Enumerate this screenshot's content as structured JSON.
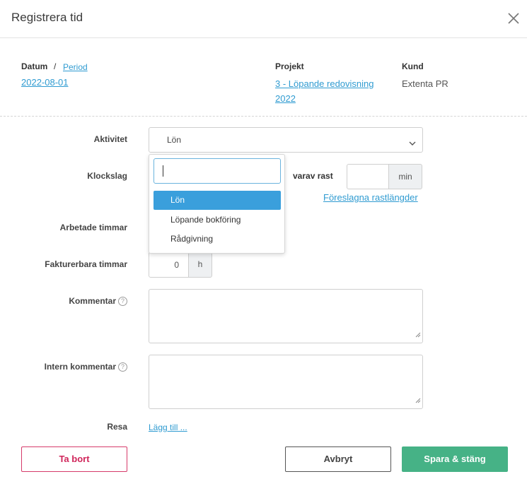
{
  "header": {
    "title": "Registrera tid"
  },
  "meta": {
    "datum_label": "Datum",
    "separator": "/",
    "period_link": "Period",
    "date_value": "2022-08-01",
    "projekt_label": "Projekt",
    "projekt_line1": "3 - Löpande redovisning",
    "projekt_line2": "2022",
    "kund_label": "Kund",
    "kund_value": "Extenta PR"
  },
  "form": {
    "aktivitet_label": "Aktivitet",
    "aktivitet_value": "Lön",
    "klockslag_label": "Klockslag",
    "varav_rast_label": "varav rast",
    "rast_unit": "min",
    "foreslagna_link": "Föreslagna rastlängder",
    "arbetade_label": "Arbetade timmar",
    "fakturerbara_label": "Fakturerbara timmar",
    "fakturerbara_value": "0",
    "hours_unit": "h",
    "kommentar_label": "Kommentar",
    "intern_label": "Intern kommentar",
    "resa_label": "Resa",
    "lagg_till_link": "Lägg till ..."
  },
  "dropdown": {
    "search_value": "",
    "options": [
      "Lön",
      "Löpande bokföring",
      "Rådgivning"
    ],
    "selected": "Lön"
  },
  "buttons": {
    "delete": "Ta bort",
    "cancel": "Avbryt",
    "save": "Spara & stäng"
  },
  "colors": {
    "link": "#2f9bd1",
    "highlight": "#3a9fdc",
    "delete": "#d0255a",
    "save": "#46b286"
  }
}
